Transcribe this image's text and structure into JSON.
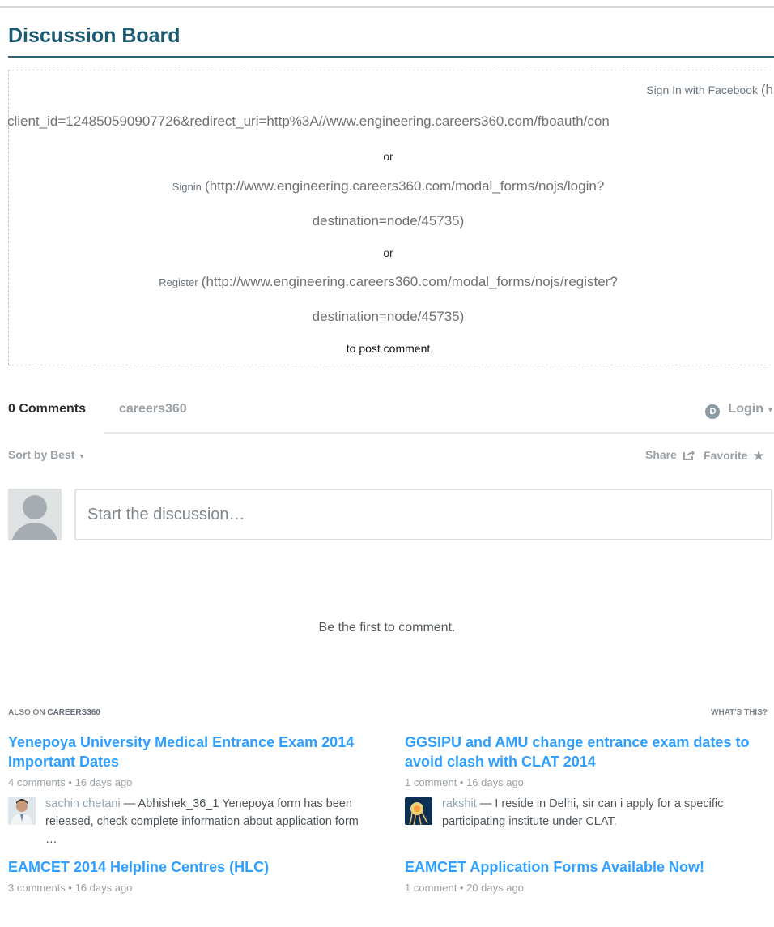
{
  "board_title": "Discussion Board",
  "login_box": {
    "facebook_label": "Sign In with Facebook",
    "facebook_paren": "(h",
    "facebook_url": "client_id=124850590907726&redirect_uri=http%3A//www.engineering.careers360.com/fboauth/con",
    "or_1": "or",
    "signin_label": "Signin",
    "signin_url_1": "(http://www.engineering.careers360.com/modal_forms/nojs/login?",
    "signin_url_2": "destination=node/45735)",
    "or_2": "or",
    "register_label": "Register",
    "register_url_1": "(http://www.engineering.careers360.com/modal_forms/nojs/register?",
    "register_url_2": "destination=node/45735)",
    "post_text": "to post comment"
  },
  "comments_bar": {
    "count_label": "0 Comments",
    "community_tab": "careers360",
    "login_label": "Login",
    "disqus_badge": "D"
  },
  "sort_bar": {
    "sort_label": "Sort by Best",
    "share_label": "Share",
    "favorite_label": "Favorite"
  },
  "composer": {
    "placeholder": "Start the discussion…"
  },
  "empty_state": "Be the first to comment.",
  "also_on": {
    "prefix": "ALSO ON ",
    "brand": "CAREERS360",
    "whats_this": "WHAT'S THIS?"
  },
  "cards": [
    {
      "title": "Yenepoya University Medical Entrance Exam 2014 Important Dates",
      "meta": "4 comments • 16 days ago",
      "author": "sachin chetani",
      "excerpt": " — Abhishek_36_1 Yenepoya form has been released, check complete information about application form …"
    },
    {
      "title": "GGSIPU and AMU change entrance exam dates to avoid clash with CLAT 2014",
      "meta": "1 comment • 16 days ago",
      "author": "rakshit",
      "excerpt": " — I reside in Delhi, sir can i apply for a specific participating institute under CLAT."
    },
    {
      "title": "EAMCET 2014 Helpline Centres (HLC)",
      "meta": "3 comments • 16 days ago"
    },
    {
      "title": "EAMCET Application Forms Available Now!",
      "meta": "1 comment • 20 days ago"
    }
  ],
  "icons": {
    "caret": "▾",
    "star": "★",
    "share": "share-icon",
    "avatar": "user-avatar-icon"
  },
  "colors": {
    "title": "#1d5b73",
    "link": "#2e9fff",
    "muted": "#9aa1a6",
    "rule": "#2f5f73"
  }
}
